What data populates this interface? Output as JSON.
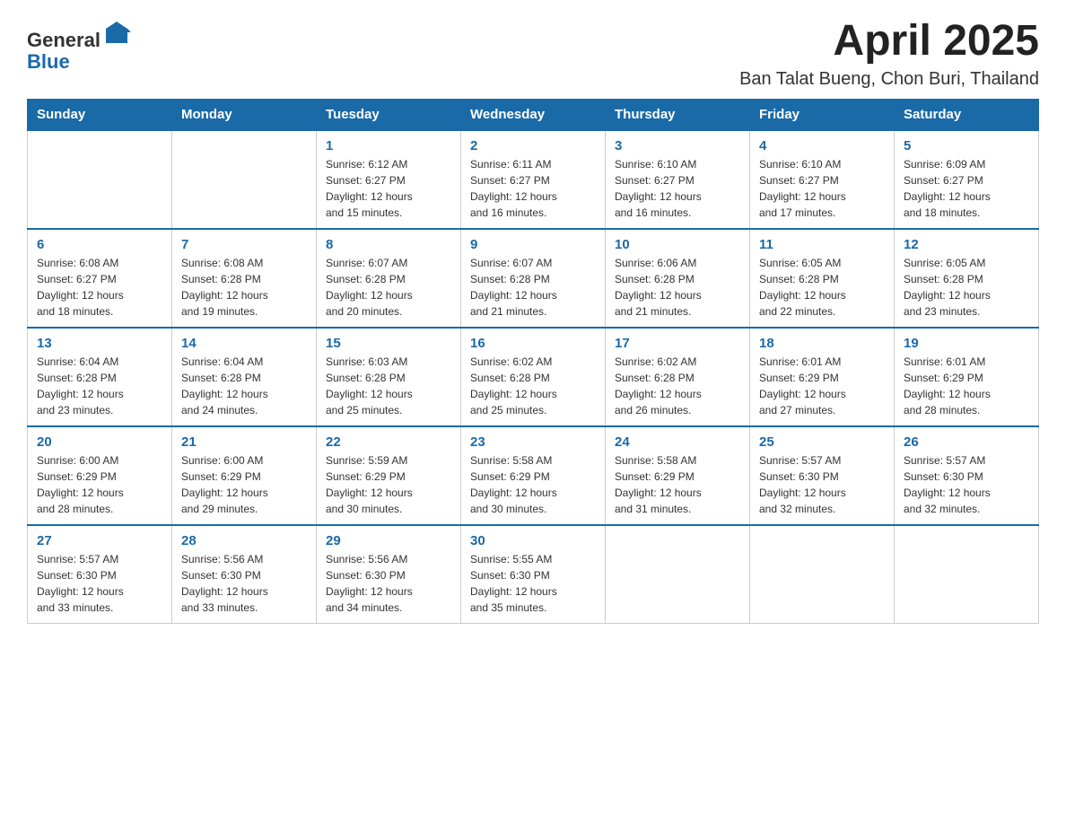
{
  "header": {
    "logo_text_general": "General",
    "logo_text_blue": "Blue",
    "month_title": "April 2025",
    "location": "Ban Talat Bueng, Chon Buri, Thailand"
  },
  "weekdays": [
    "Sunday",
    "Monday",
    "Tuesday",
    "Wednesday",
    "Thursday",
    "Friday",
    "Saturday"
  ],
  "weeks": [
    [
      {
        "day": "",
        "info": ""
      },
      {
        "day": "",
        "info": ""
      },
      {
        "day": "1",
        "info": "Sunrise: 6:12 AM\nSunset: 6:27 PM\nDaylight: 12 hours\nand 15 minutes."
      },
      {
        "day": "2",
        "info": "Sunrise: 6:11 AM\nSunset: 6:27 PM\nDaylight: 12 hours\nand 16 minutes."
      },
      {
        "day": "3",
        "info": "Sunrise: 6:10 AM\nSunset: 6:27 PM\nDaylight: 12 hours\nand 16 minutes."
      },
      {
        "day": "4",
        "info": "Sunrise: 6:10 AM\nSunset: 6:27 PM\nDaylight: 12 hours\nand 17 minutes."
      },
      {
        "day": "5",
        "info": "Sunrise: 6:09 AM\nSunset: 6:27 PM\nDaylight: 12 hours\nand 18 minutes."
      }
    ],
    [
      {
        "day": "6",
        "info": "Sunrise: 6:08 AM\nSunset: 6:27 PM\nDaylight: 12 hours\nand 18 minutes."
      },
      {
        "day": "7",
        "info": "Sunrise: 6:08 AM\nSunset: 6:28 PM\nDaylight: 12 hours\nand 19 minutes."
      },
      {
        "day": "8",
        "info": "Sunrise: 6:07 AM\nSunset: 6:28 PM\nDaylight: 12 hours\nand 20 minutes."
      },
      {
        "day": "9",
        "info": "Sunrise: 6:07 AM\nSunset: 6:28 PM\nDaylight: 12 hours\nand 21 minutes."
      },
      {
        "day": "10",
        "info": "Sunrise: 6:06 AM\nSunset: 6:28 PM\nDaylight: 12 hours\nand 21 minutes."
      },
      {
        "day": "11",
        "info": "Sunrise: 6:05 AM\nSunset: 6:28 PM\nDaylight: 12 hours\nand 22 minutes."
      },
      {
        "day": "12",
        "info": "Sunrise: 6:05 AM\nSunset: 6:28 PM\nDaylight: 12 hours\nand 23 minutes."
      }
    ],
    [
      {
        "day": "13",
        "info": "Sunrise: 6:04 AM\nSunset: 6:28 PM\nDaylight: 12 hours\nand 23 minutes."
      },
      {
        "day": "14",
        "info": "Sunrise: 6:04 AM\nSunset: 6:28 PM\nDaylight: 12 hours\nand 24 minutes."
      },
      {
        "day": "15",
        "info": "Sunrise: 6:03 AM\nSunset: 6:28 PM\nDaylight: 12 hours\nand 25 minutes."
      },
      {
        "day": "16",
        "info": "Sunrise: 6:02 AM\nSunset: 6:28 PM\nDaylight: 12 hours\nand 25 minutes."
      },
      {
        "day": "17",
        "info": "Sunrise: 6:02 AM\nSunset: 6:28 PM\nDaylight: 12 hours\nand 26 minutes."
      },
      {
        "day": "18",
        "info": "Sunrise: 6:01 AM\nSunset: 6:29 PM\nDaylight: 12 hours\nand 27 minutes."
      },
      {
        "day": "19",
        "info": "Sunrise: 6:01 AM\nSunset: 6:29 PM\nDaylight: 12 hours\nand 28 minutes."
      }
    ],
    [
      {
        "day": "20",
        "info": "Sunrise: 6:00 AM\nSunset: 6:29 PM\nDaylight: 12 hours\nand 28 minutes."
      },
      {
        "day": "21",
        "info": "Sunrise: 6:00 AM\nSunset: 6:29 PM\nDaylight: 12 hours\nand 29 minutes."
      },
      {
        "day": "22",
        "info": "Sunrise: 5:59 AM\nSunset: 6:29 PM\nDaylight: 12 hours\nand 30 minutes."
      },
      {
        "day": "23",
        "info": "Sunrise: 5:58 AM\nSunset: 6:29 PM\nDaylight: 12 hours\nand 30 minutes."
      },
      {
        "day": "24",
        "info": "Sunrise: 5:58 AM\nSunset: 6:29 PM\nDaylight: 12 hours\nand 31 minutes."
      },
      {
        "day": "25",
        "info": "Sunrise: 5:57 AM\nSunset: 6:30 PM\nDaylight: 12 hours\nand 32 minutes."
      },
      {
        "day": "26",
        "info": "Sunrise: 5:57 AM\nSunset: 6:30 PM\nDaylight: 12 hours\nand 32 minutes."
      }
    ],
    [
      {
        "day": "27",
        "info": "Sunrise: 5:57 AM\nSunset: 6:30 PM\nDaylight: 12 hours\nand 33 minutes."
      },
      {
        "day": "28",
        "info": "Sunrise: 5:56 AM\nSunset: 6:30 PM\nDaylight: 12 hours\nand 33 minutes."
      },
      {
        "day": "29",
        "info": "Sunrise: 5:56 AM\nSunset: 6:30 PM\nDaylight: 12 hours\nand 34 minutes."
      },
      {
        "day": "30",
        "info": "Sunrise: 5:55 AM\nSunset: 6:30 PM\nDaylight: 12 hours\nand 35 minutes."
      },
      {
        "day": "",
        "info": ""
      },
      {
        "day": "",
        "info": ""
      },
      {
        "day": "",
        "info": ""
      }
    ]
  ]
}
